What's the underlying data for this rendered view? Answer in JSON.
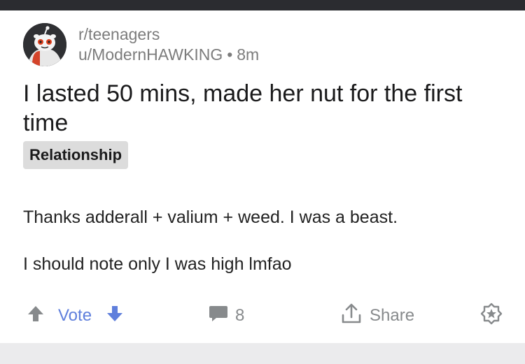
{
  "post": {
    "subreddit": "r/teenagers",
    "username": "u/ModernHAWKING",
    "separator": "•",
    "age": "8m",
    "title": "I lasted 50 mins, made her nut for the first time",
    "flair": "Relationship",
    "body": [
      "Thanks adderall + valium + weed. I was a beast.",
      "I should note only I was high lmfao"
    ]
  },
  "actions": {
    "vote_label": "Vote",
    "comment_count": "8",
    "share_label": "Share"
  },
  "icons": {
    "upvote": "upvote-arrow-icon",
    "downvote": "downvote-arrow-icon",
    "comment": "comment-bubble-icon",
    "share": "share-upload-icon",
    "award": "award-badge-icon"
  },
  "colors": {
    "vote_blue": "#5f7fdc",
    "muted_gray": "#878a8c",
    "top_bar": "#2b2c30"
  }
}
